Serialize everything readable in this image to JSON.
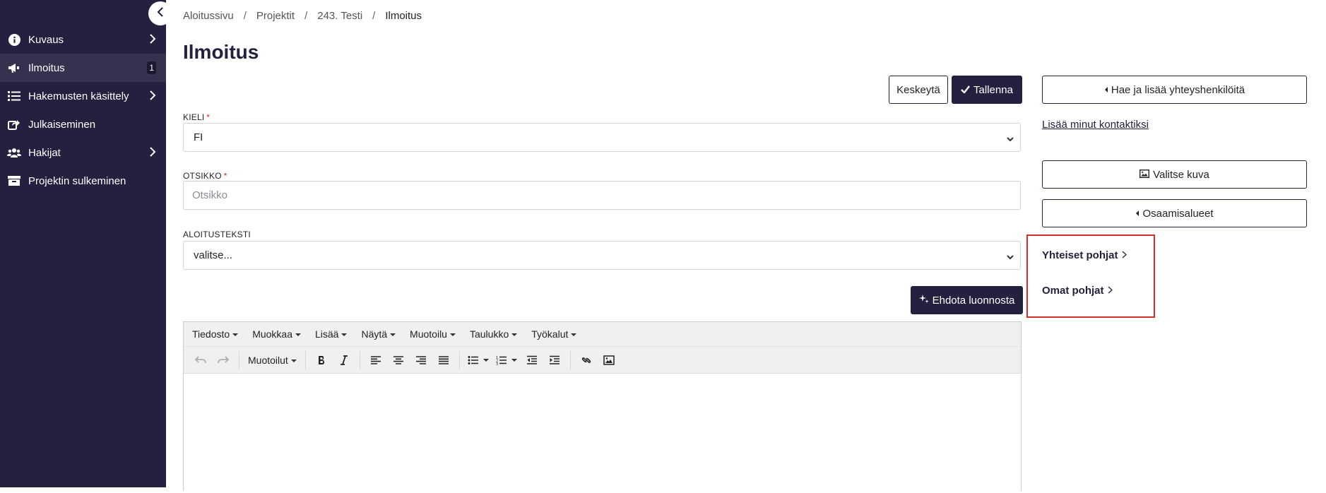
{
  "sidebar": {
    "items": [
      {
        "label": "Kuvaus",
        "icon": "info-icon"
      },
      {
        "label": "Ilmoitus",
        "icon": "megaphone-icon",
        "badge": "1"
      },
      {
        "label": "Hakemusten käsittely",
        "icon": "list-icon"
      },
      {
        "label": "Julkaiseminen",
        "icon": "share-icon"
      },
      {
        "label": "Hakijat",
        "icon": "users-icon"
      },
      {
        "label": "Projektin sulkeminen",
        "icon": "archive-icon"
      }
    ]
  },
  "breadcrumb": {
    "items": [
      "Aloitussivu",
      "Projektit",
      "243. Testi"
    ],
    "current": "Ilmoitus",
    "separator": "/"
  },
  "page": {
    "title": "Ilmoitus"
  },
  "actions": {
    "cancel_label": "Keskeytä",
    "save_label": "Tallenna"
  },
  "form": {
    "language": {
      "label": "KIELI",
      "value": "FI"
    },
    "title": {
      "label": "OTSIKKO",
      "placeholder": "Otsikko"
    },
    "intro": {
      "label": "ALOITUSTEKSTI",
      "value": "valitse..."
    },
    "suggest_label": "Ehdota luonnosta"
  },
  "editor": {
    "menu": [
      "Tiedosto",
      "Muokkaa",
      "Lisää",
      "Näytä",
      "Muotoilu",
      "Taulukko",
      "Työkalut"
    ],
    "formats_label": "Muotoilut"
  },
  "right": {
    "contacts_button": "Hae ja lisää yhteyshenkilöitä",
    "add_me_link": "Lisää minut kontaktiksi",
    "choose_image_button": "Valitse kuva",
    "expertise_button": "Osaamisalueet",
    "shared_templates": "Yhteiset pohjat",
    "own_templates": "Omat pohjat"
  },
  "colors": {
    "sidebar_bg": "#24203f",
    "accent": "#24203f",
    "highlight_border": "#d32f2f"
  }
}
